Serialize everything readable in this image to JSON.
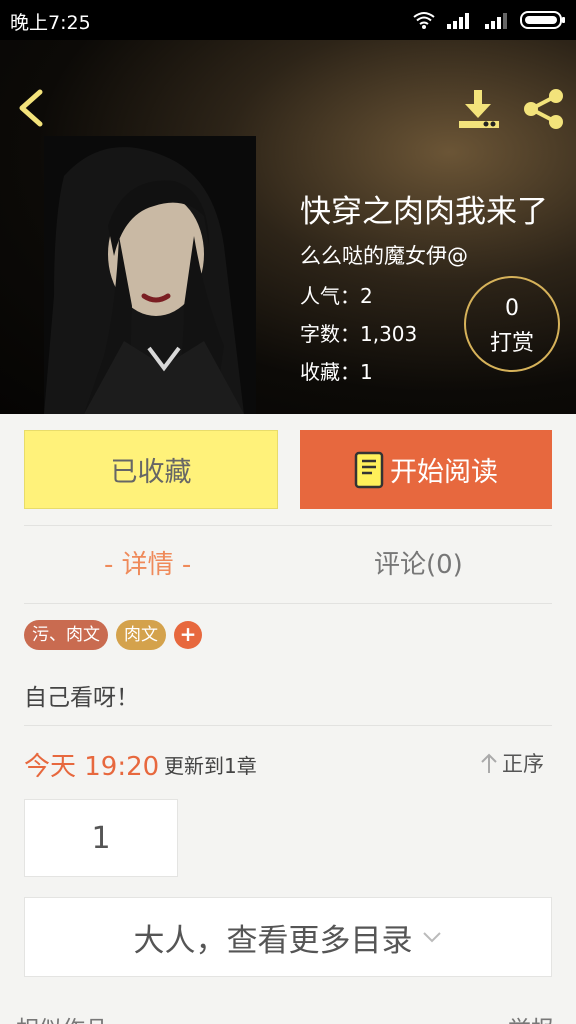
{
  "status_bar": {
    "time": "晚上7:25"
  },
  "book": {
    "title": "快穿之肉肉我来了",
    "author": "么么哒的魔女伊@",
    "popularity": "人气：2",
    "word_count": "字数：1,303",
    "favorites": "收藏：1"
  },
  "reward": {
    "count": "0",
    "label": "打赏"
  },
  "actions": {
    "favorite_label": "已收藏",
    "read_label": "开始阅读"
  },
  "tabs": {
    "detail": "- 详情 -",
    "comments": "评论(0)"
  },
  "tags": [
    "污、肉文",
    "肉文"
  ],
  "add_tag_label": "+",
  "description": "自己看呀！",
  "update": {
    "time": "今天 19:20",
    "text": "更新到1章",
    "sort_label": "正序"
  },
  "chapters": [
    "1"
  ],
  "more_catalog_label": "大人，查看更多目录",
  "similar": {
    "left": "相似作品",
    "right": "举报"
  },
  "colors": {
    "accent": "#e7683e",
    "favorite_bg": "#fff27a",
    "ring": "#d6b25a",
    "tag_red": "#c96b50",
    "tag_gold": "#d4a24c"
  }
}
